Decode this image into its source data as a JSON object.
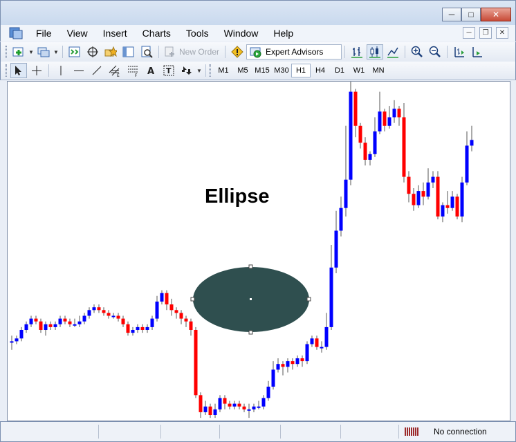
{
  "menu": [
    "File",
    "View",
    "Insert",
    "Charts",
    "Tools",
    "Window",
    "Help"
  ],
  "toolbar": {
    "new_order_label": "New Order",
    "expert_advisors_label": "Expert Advisors"
  },
  "timeframes": [
    "M1",
    "M5",
    "M15",
    "M30",
    "H1",
    "H4",
    "D1",
    "W1",
    "MN"
  ],
  "active_timeframe": "H1",
  "chart": {
    "object_label": "Ellipse",
    "ellipse_fill": "#2f4f4f",
    "bull_color": "#0000ff",
    "bear_color": "#ff0000",
    "ohlc": [
      [
        6,
        6,
        8,
        3
      ],
      [
        6,
        7,
        8,
        5
      ],
      [
        7,
        10,
        11,
        6
      ],
      [
        10,
        12,
        13,
        9
      ],
      [
        12,
        14,
        15,
        11
      ],
      [
        14,
        13,
        15,
        12
      ],
      [
        13,
        10,
        14,
        9
      ],
      [
        10,
        12,
        13,
        8
      ],
      [
        12,
        11,
        13,
        10
      ],
      [
        11,
        12,
        13,
        10
      ],
      [
        12,
        14,
        15,
        11
      ],
      [
        14,
        13,
        15,
        12
      ],
      [
        13,
        12,
        14,
        11
      ],
      [
        12,
        12,
        14,
        11
      ],
      [
        12,
        13,
        15,
        11
      ],
      [
        13,
        15,
        16,
        12
      ],
      [
        15,
        17,
        18,
        14
      ],
      [
        17,
        18,
        19,
        16
      ],
      [
        18,
        17,
        19,
        16
      ],
      [
        17,
        16,
        18,
        15
      ],
      [
        16,
        15,
        17,
        14
      ],
      [
        15,
        15,
        16,
        14
      ],
      [
        15,
        14,
        16,
        13
      ],
      [
        14,
        12,
        15,
        11
      ],
      [
        12,
        9,
        13,
        8
      ],
      [
        9,
        10,
        11,
        8
      ],
      [
        10,
        11,
        12,
        9
      ],
      [
        11,
        10,
        12,
        9
      ],
      [
        10,
        11,
        12,
        9
      ],
      [
        11,
        14,
        15,
        10
      ],
      [
        14,
        20,
        22,
        13
      ],
      [
        20,
        23,
        24,
        19
      ],
      [
        23,
        19,
        24,
        17
      ],
      [
        19,
        17,
        21,
        15
      ],
      [
        17,
        16,
        18,
        14
      ],
      [
        16,
        14,
        17,
        12
      ],
      [
        14,
        13,
        15,
        11
      ],
      [
        13,
        10,
        14,
        8
      ],
      [
        10,
        -13,
        11,
        -14
      ],
      [
        -13,
        -19,
        -12,
        -21
      ],
      [
        -19,
        -17,
        -15,
        -20
      ],
      [
        -17,
        -20,
        -16,
        -21
      ],
      [
        -20,
        -18,
        -16,
        -21
      ],
      [
        -18,
        -14,
        -13,
        -19
      ],
      [
        -14,
        -16,
        -13,
        -18
      ],
      [
        -16,
        -17,
        -15,
        -18
      ],
      [
        -17,
        -16,
        -15,
        -18
      ],
      [
        -16,
        -17,
        -15,
        -18
      ],
      [
        -17,
        -18,
        -16,
        -19
      ],
      [
        -18,
        -18,
        -16,
        -21
      ],
      [
        -18,
        -17,
        -16,
        -19
      ],
      [
        -17,
        -17,
        -15,
        -18
      ],
      [
        -17,
        -14,
        -13,
        -18
      ],
      [
        -14,
        -10,
        -8,
        -15
      ],
      [
        -10,
        -4,
        -1,
        -11
      ],
      [
        -4,
        -2,
        0,
        -5
      ],
      [
        -2,
        -3,
        -1,
        -6
      ],
      [
        -3,
        -1,
        0,
        -5
      ],
      [
        -1,
        -2,
        0,
        -4
      ],
      [
        -2,
        0,
        1,
        -3
      ],
      [
        0,
        -1,
        1,
        -3
      ],
      [
        -1,
        5,
        6,
        -2
      ],
      [
        5,
        7,
        8,
        4
      ],
      [
        7,
        4,
        8,
        3
      ],
      [
        4,
        4,
        6,
        2
      ],
      [
        4,
        11,
        16,
        3
      ],
      [
        11,
        32,
        40,
        10
      ],
      [
        32,
        45,
        52,
        30
      ],
      [
        45,
        53,
        57,
        43
      ],
      [
        53,
        63,
        82,
        50
      ],
      [
        63,
        94,
        100,
        61
      ],
      [
        94,
        82,
        95,
        78
      ],
      [
        82,
        76,
        83,
        74
      ],
      [
        76,
        70,
        78,
        68
      ],
      [
        70,
        72,
        73,
        68
      ],
      [
        72,
        80,
        85,
        71
      ],
      [
        80,
        87,
        94,
        79
      ],
      [
        87,
        82,
        88,
        80
      ],
      [
        82,
        85,
        89,
        81
      ],
      [
        85,
        88,
        91,
        83
      ],
      [
        88,
        85,
        89,
        82
      ],
      [
        85,
        64,
        90,
        62
      ],
      [
        64,
        58,
        66,
        55
      ],
      [
        58,
        54,
        60,
        52
      ],
      [
        54,
        59,
        61,
        53
      ],
      [
        59,
        57,
        62,
        54
      ],
      [
        57,
        62,
        67,
        56
      ],
      [
        62,
        64,
        66,
        60
      ],
      [
        64,
        50,
        66,
        49
      ],
      [
        50,
        54,
        55,
        48
      ],
      [
        54,
        53,
        59,
        51
      ],
      [
        53,
        57,
        59,
        52
      ],
      [
        57,
        50,
        58,
        49
      ],
      [
        50,
        62,
        64,
        48
      ],
      [
        62,
        75,
        80,
        61
      ],
      [
        75,
        77,
        82,
        73
      ]
    ]
  },
  "status": {
    "connection": "No connection"
  }
}
